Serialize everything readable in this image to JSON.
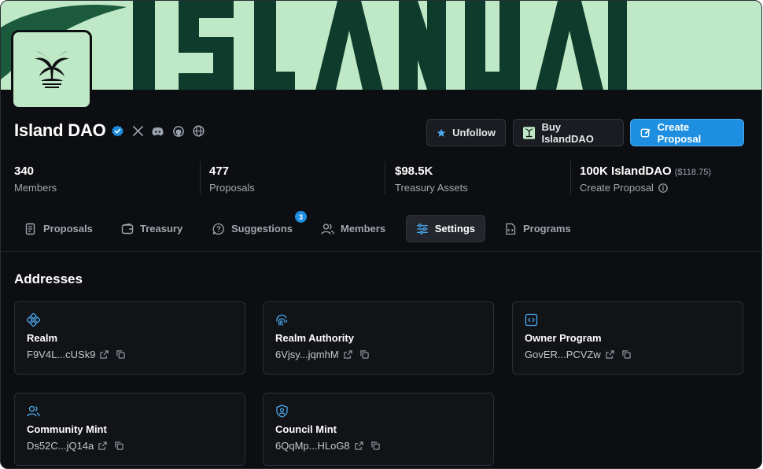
{
  "dao": {
    "name": "Island DAO"
  },
  "actions": {
    "unfollow": "Unfollow",
    "buy": "Buy IslandDAO",
    "create": "Create Proposal"
  },
  "stats": [
    {
      "value": "340",
      "label": "Members"
    },
    {
      "value": "477",
      "label": "Proposals"
    },
    {
      "value": "$98.5K",
      "label": "Treasury Assets"
    },
    {
      "value": "100K IslandDAO",
      "extra": "($118.75)",
      "label": "Create Proposal"
    }
  ],
  "tabs": [
    {
      "label": "Proposals",
      "icon": "proposals-icon"
    },
    {
      "label": "Treasury",
      "icon": "wallet-icon"
    },
    {
      "label": "Suggestions",
      "icon": "chat-question-icon",
      "badge": "3"
    },
    {
      "label": "Members",
      "icon": "users-icon"
    },
    {
      "label": "Settings",
      "icon": "sliders-icon",
      "active": true
    },
    {
      "label": "Programs",
      "icon": "code-file-icon"
    }
  ],
  "addresses": {
    "title": "Addresses",
    "items": [
      {
        "label": "Realm",
        "value": "F9V4L...cUSk9",
        "icon": "realm-icon"
      },
      {
        "label": "Realm Authority",
        "value": "6Vjsy...jqmhM",
        "icon": "fingerprint-icon"
      },
      {
        "label": "Owner Program",
        "value": "GovER...PCVZw",
        "icon": "code-icon"
      },
      {
        "label": "Community Mint",
        "value": "Ds52C...jQ14a",
        "icon": "users-icon"
      },
      {
        "label": "Council Mint",
        "value": "6QqMp...HLoG8",
        "icon": "shield-user-icon"
      }
    ]
  },
  "colors": {
    "accent": "#1e8fe0",
    "banner": "#bfe9c6",
    "banner_text": "#0f3b2c",
    "background": "#0d0e11"
  }
}
